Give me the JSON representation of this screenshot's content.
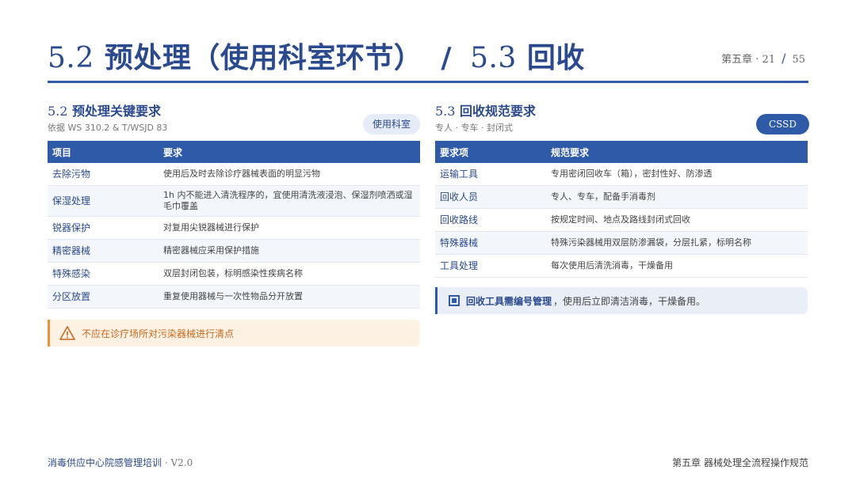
{
  "header": {
    "title_num_1": "5.2",
    "title_text_1": "预处理（使用科室环节）",
    "title_slash": "/",
    "title_num_2": "5.3",
    "title_text_2": "回收",
    "chapter": "第五章",
    "sep": "·",
    "page": "21",
    "page_slash": "/",
    "total": "55"
  },
  "left": {
    "title_num": "5.2",
    "title_text": "预处理关键要求",
    "subtitle": "依据 WS 310.2 & T/WSJD 83",
    "tag": "使用科室",
    "headers": [
      "项目",
      "要求"
    ],
    "rows": [
      {
        "key": "去除污物",
        "value": "使用后及时去除诊疗器械表面的明显污物"
      },
      {
        "key": "保湿处理",
        "value": "1h 内不能进入清洗程序的，宜使用清洗液浸泡、保湿剂喷洒或湿毛巾覆盖"
      },
      {
        "key": "锐器保护",
        "value": "对复用尖锐器械进行保护"
      },
      {
        "key": "精密器械",
        "value": "精密器械应采用保护措施"
      },
      {
        "key": "特殊感染",
        "value": "双层封闭包装，标明感染性疾病名称"
      },
      {
        "key": "分区放置",
        "value": "重复使用器械与一次性物品分开放置"
      }
    ],
    "warning": "不应在诊疗场所对污染器械进行清点"
  },
  "right": {
    "title_num": "5.3",
    "title_text": "回收规范要求",
    "subtitle": "专人 · 专车 · 封闭式",
    "tag": "CSSD",
    "headers": [
      "要求项",
      "规范要求"
    ],
    "rows": [
      {
        "key": "运输工具",
        "value": "专用密闭回收车（箱），密封性好、防渗透"
      },
      {
        "key": "回收人员",
        "value": "专人、专车，配备手消毒剂"
      },
      {
        "key": "回收路线",
        "value": "按规定时间、地点及路线封闭式回收"
      },
      {
        "key": "特殊器械",
        "value": "特殊污染器械用双层防渗漏袋，分层扎紧，标明名称"
      },
      {
        "key": "工具处理",
        "value": "每次使用后清洗消毒，干燥备用"
      }
    ],
    "note_bold": "回收工具需编号管理",
    "note_text": "，使用后立即清洁消毒，干燥备用。"
  },
  "footer": {
    "left": "消毒供应中心院感管理培训",
    "sep": " · ",
    "version": "V2.0",
    "right": "第五章 器械处理全流程操作规范"
  },
  "colors": {
    "primary": "#2f5aa8",
    "title": "#2b4a8e",
    "warning": "#e8923a"
  },
  "icons": {
    "warning": "warning-triangle-icon",
    "note": "square-bullet-icon"
  }
}
